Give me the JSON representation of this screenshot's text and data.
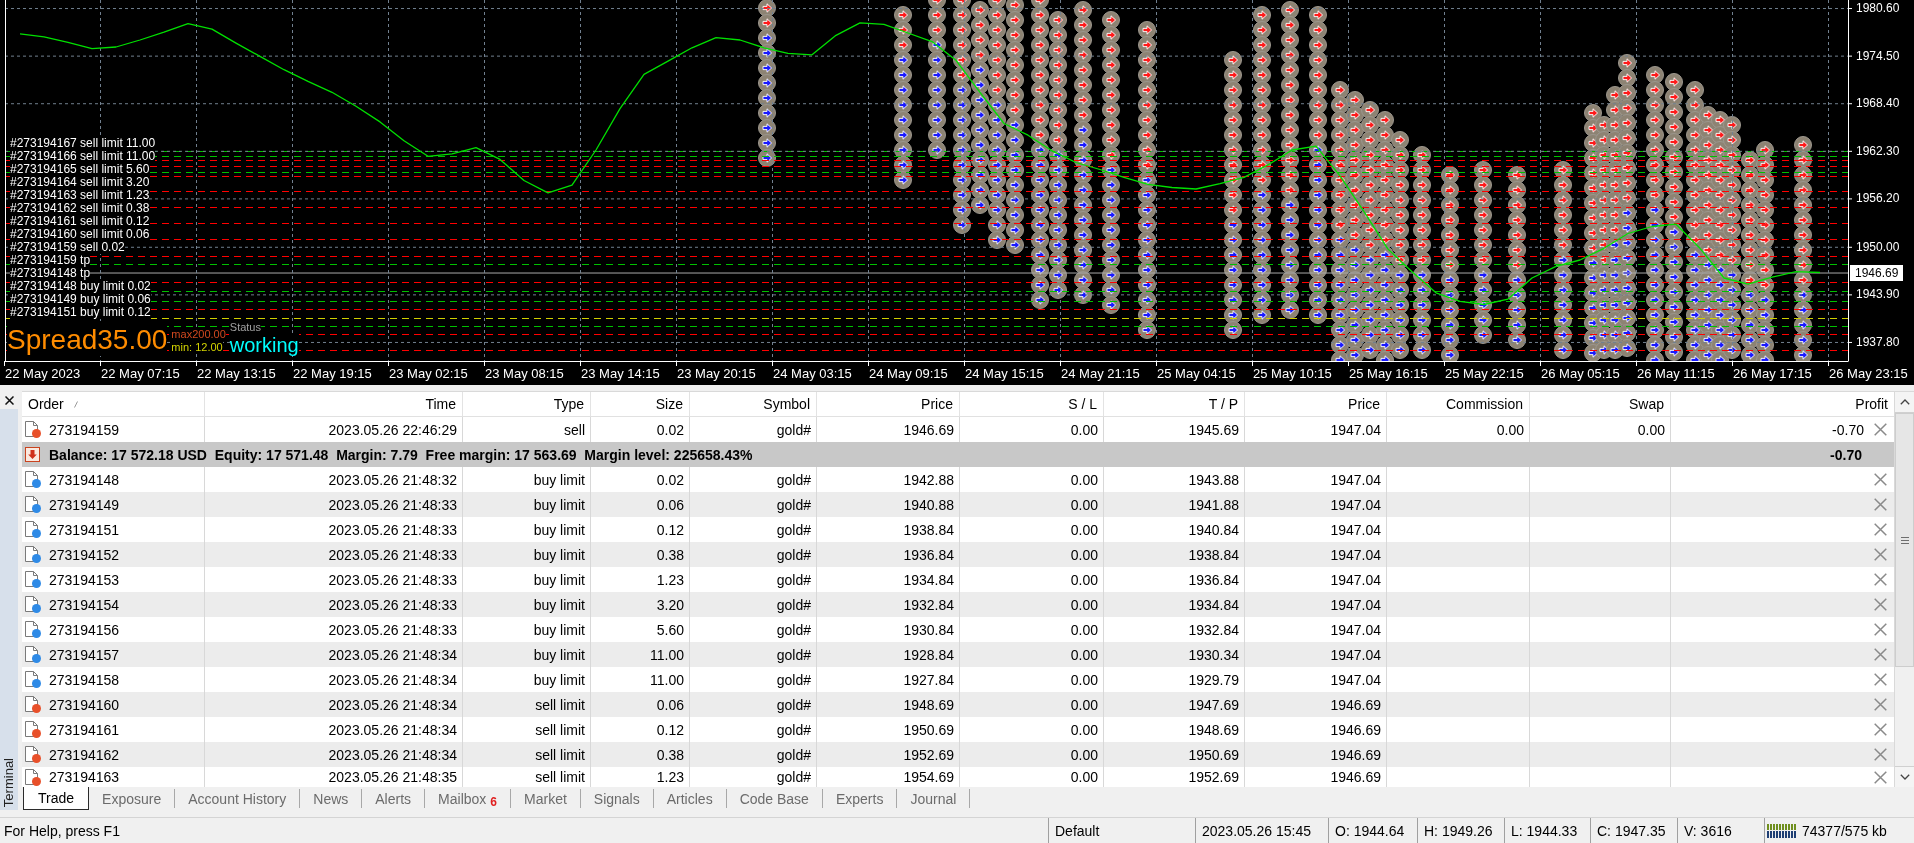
{
  "chart": {
    "chart_data": {
      "type": "line",
      "categories": [
        null,
        "22 May 2023",
        null,
        null,
        null,
        "22 May 07:15",
        null,
        null,
        null,
        "22 May 13:15",
        null,
        null,
        null,
        "22 May 19:15",
        null,
        null,
        null,
        "23 May 02:15",
        null,
        null,
        null,
        "23 May 08:15",
        null,
        null,
        null,
        "23 May 14:15",
        null,
        null,
        null,
        "23 May 20:15",
        null,
        null,
        null,
        "24 May 03:15",
        null,
        null,
        null,
        "24 May 09:15",
        null,
        null,
        null,
        "24 May 15:15",
        null,
        null,
        null,
        "24 May 21:15",
        null,
        null,
        null,
        "25 May 04:15",
        null,
        null,
        null,
        "25 May 10:15",
        null,
        null,
        null,
        "25 May 16:15",
        null,
        null,
        null,
        "25 May 22:15",
        null,
        null,
        null,
        "26 May 05:15",
        null,
        null,
        null,
        "26 May 11:15",
        null,
        null,
        null,
        "26 May 17:15",
        null,
        null,
        null,
        "26 May 23:15"
      ],
      "values": [
        1977.3,
        1976.9,
        1976.2,
        1975.4,
        1975.6,
        1976.5,
        1977.5,
        1978.6,
        1977.9,
        1976.1,
        1974.4,
        1972.7,
        1971.2,
        1969.8,
        1968.0,
        1966.0,
        1963.6,
        1961.6,
        1961.9,
        1962.7,
        1961.2,
        1958.5,
        1956.9,
        1957.9,
        1962.4,
        1967.7,
        1972.1,
        1973.8,
        1975.5,
        1976.8,
        1976.5,
        1975.5,
        1974.8,
        1974.6,
        1977.1,
        1978.7,
        1978.5,
        1977.4,
        1976.3,
        1973.9,
        1969.8,
        1965.8,
        1964.3,
        1962.3,
        1960.8,
        1959.9,
        1958.9,
        1958.0,
        1957.6,
        1957.4,
        1958.1,
        1958.9,
        1960.5,
        1962.4,
        1962.9,
        1959.1,
        1954.5,
        1949.7,
        1946.8,
        1944.1,
        1943.0,
        1942.6,
        1943.3,
        1946.0,
        1947.5,
        1948.3,
        1949.8,
        1951.7,
        1952.6,
        1952.9,
        1949.8,
        1946.0,
        1945.2,
        1946.1,
        1946.8,
        1946.7,
        null,
        null
      ],
      "ylim": [
        1935.36,
        1981.63
      ],
      "yticks": [
        {
          "value": 1980.6,
          "label": "1980.60"
        },
        {
          "value": 1974.5,
          "label": "1974.50"
        },
        {
          "value": 1968.4,
          "label": "1968.40"
        },
        {
          "value": 1962.3,
          "label": "1962.30"
        },
        {
          "value": 1956.2,
          "label": "1956.20"
        },
        {
          "value": 1950.0,
          "label": "1950.00"
        },
        {
          "value": 1943.9,
          "label": "1943.90"
        },
        {
          "value": 1937.8,
          "label": "1937.80"
        }
      ],
      "grid": true,
      "annotations": [
        "1946.69"
      ]
    },
    "order_labels": [
      "#273194167 sell limit 11.00",
      "#273194166 sell limit 11.00",
      "#273194165 sell limit 5.60",
      "#273194164 sell limit 3.20",
      "#273194163 sell limit 1.23",
      "#273194162 sell limit 0.38",
      "#273194161 sell limit 0.12",
      "#273194160 sell limit 0.06",
      "#273194159 sell 0.02",
      "#273194159 tp",
      "#273194148 tp",
      "#273194148 buy limit 0.02",
      "#273194149 buy limit 0.06",
      "#273194151 buy limit 0.12"
    ],
    "indicator": {
      "spread": "Spread35.00",
      "max": "max200.00",
      "min": "min: 12.00",
      "status_label": "Status",
      "status": "working"
    }
  },
  "terminal": {
    "title": "Terminal"
  },
  "table": {
    "columns": [
      {
        "label": "Order",
        "sorted": true
      },
      {
        "label": "Time",
        "sorted": false
      },
      {
        "label": "Type",
        "sorted": false
      },
      {
        "label": "Size",
        "sorted": false
      },
      {
        "label": "Symbol",
        "sorted": false
      },
      {
        "label": "Price",
        "sorted": false
      },
      {
        "label": "S / L",
        "sorted": false
      },
      {
        "label": "T / P",
        "sorted": false
      },
      {
        "label": "Price",
        "sorted": false
      },
      {
        "label": "Commission",
        "sorted": false
      },
      {
        "label": "Swap",
        "sorted": false
      },
      {
        "label": "Profit",
        "sorted": false
      }
    ],
    "rows": [
      {
        "kind": "trade",
        "color": "#e8502a",
        "order": "273194159",
        "time": "2023.05.26 22:46:29",
        "type": "sell",
        "size": "0.02",
        "symbol": "gold#",
        "price": "1946.69",
        "sl": "0.00",
        "tp": "1945.69",
        "market_price": "1947.04",
        "commission": "0.00",
        "swap": "0.00",
        "profit": "-0.70"
      },
      {
        "kind": "summary",
        "text": "Balance: 17 572.18 USD  Equity: 17 571.48  Margin: 7.79  Free margin: 17 563.69  Margin level: 225658.43%",
        "profit": "-0.70"
      },
      {
        "kind": "trade",
        "color": "#2e8ae6",
        "order": "273194148",
        "time": "2023.05.26 21:48:32",
        "type": "buy limit",
        "size": "0.02",
        "symbol": "gold#",
        "price": "1942.88",
        "sl": "0.00",
        "tp": "1943.88",
        "market_price": "1947.04"
      },
      {
        "kind": "trade",
        "color": "#2e8ae6",
        "order": "273194149",
        "time": "2023.05.26 21:48:33",
        "type": "buy limit",
        "size": "0.06",
        "symbol": "gold#",
        "price": "1940.88",
        "sl": "0.00",
        "tp": "1941.88",
        "market_price": "1947.04"
      },
      {
        "kind": "trade",
        "color": "#2e8ae6",
        "order": "273194151",
        "time": "2023.05.26 21:48:33",
        "type": "buy limit",
        "size": "0.12",
        "symbol": "gold#",
        "price": "1938.84",
        "sl": "0.00",
        "tp": "1940.84",
        "market_price": "1947.04"
      },
      {
        "kind": "trade",
        "color": "#2e8ae6",
        "order": "273194152",
        "time": "2023.05.26 21:48:33",
        "type": "buy limit",
        "size": "0.38",
        "symbol": "gold#",
        "price": "1936.84",
        "sl": "0.00",
        "tp": "1938.84",
        "market_price": "1947.04"
      },
      {
        "kind": "trade",
        "color": "#2e8ae6",
        "order": "273194153",
        "time": "2023.05.26 21:48:33",
        "type": "buy limit",
        "size": "1.23",
        "symbol": "gold#",
        "price": "1934.84",
        "sl": "0.00",
        "tp": "1936.84",
        "market_price": "1947.04"
      },
      {
        "kind": "trade",
        "color": "#2e8ae6",
        "order": "273194154",
        "time": "2023.05.26 21:48:33",
        "type": "buy limit",
        "size": "3.20",
        "symbol": "gold#",
        "price": "1932.84",
        "sl": "0.00",
        "tp": "1934.84",
        "market_price": "1947.04"
      },
      {
        "kind": "trade",
        "color": "#2e8ae6",
        "order": "273194156",
        "time": "2023.05.26 21:48:33",
        "type": "buy limit",
        "size": "5.60",
        "symbol": "gold#",
        "price": "1930.84",
        "sl": "0.00",
        "tp": "1932.84",
        "market_price": "1947.04"
      },
      {
        "kind": "trade",
        "color": "#2e8ae6",
        "order": "273194157",
        "time": "2023.05.26 21:48:34",
        "type": "buy limit",
        "size": "11.00",
        "symbol": "gold#",
        "price": "1928.84",
        "sl": "0.00",
        "tp": "1930.34",
        "market_price": "1947.04"
      },
      {
        "kind": "trade",
        "color": "#2e8ae6",
        "order": "273194158",
        "time": "2023.05.26 21:48:34",
        "type": "buy limit",
        "size": "11.00",
        "symbol": "gold#",
        "price": "1927.84",
        "sl": "0.00",
        "tp": "1929.79",
        "market_price": "1947.04"
      },
      {
        "kind": "trade",
        "color": "#e8502a",
        "order": "273194160",
        "time": "2023.05.26 21:48:34",
        "type": "sell limit",
        "size": "0.06",
        "symbol": "gold#",
        "price": "1948.69",
        "sl": "0.00",
        "tp": "1947.69",
        "market_price": "1946.69"
      },
      {
        "kind": "trade",
        "color": "#e8502a",
        "order": "273194161",
        "time": "2023.05.26 21:48:34",
        "type": "sell limit",
        "size": "0.12",
        "symbol": "gold#",
        "price": "1950.69",
        "sl": "0.00",
        "tp": "1948.69",
        "market_price": "1946.69"
      },
      {
        "kind": "trade",
        "color": "#e8502a",
        "order": "273194162",
        "time": "2023.05.26 21:48:34",
        "type": "sell limit",
        "size": "0.38",
        "symbol": "gold#",
        "price": "1952.69",
        "sl": "0.00",
        "tp": "1950.69",
        "market_price": "1946.69"
      },
      {
        "kind": "trade",
        "color": "#e8502a",
        "order": "273194163",
        "time": "2023.05.26 21:48:35",
        "type": "sell limit",
        "size": "1.23",
        "symbol": "gold#",
        "price": "1954.69",
        "sl": "0.00",
        "tp": "1952.69",
        "market_price": "1946.69"
      }
    ]
  },
  "tabs": [
    {
      "label": "Trade",
      "selected": true
    },
    {
      "label": "Exposure",
      "selected": false
    },
    {
      "label": "Account History",
      "selected": false
    },
    {
      "label": "News",
      "selected": false
    },
    {
      "label": "Alerts",
      "selected": false
    },
    {
      "label": "Mailbox",
      "selected": false,
      "badge": "6"
    },
    {
      "label": "Market",
      "selected": false
    },
    {
      "label": "Signals",
      "selected": false
    },
    {
      "label": "Articles",
      "selected": false
    },
    {
      "label": "Code Base",
      "selected": false
    },
    {
      "label": "Experts",
      "selected": false
    },
    {
      "label": "Journal",
      "selected": false
    }
  ],
  "status_bar": {
    "help": "For Help, press F1",
    "sections": [
      "Default",
      "2023.05.26 15:45",
      "O: 1944.64",
      "H: 1949.26",
      "L: 1944.33",
      "C: 1947.35",
      "V: 3616"
    ],
    "traffic": "74377/575 kb"
  }
}
